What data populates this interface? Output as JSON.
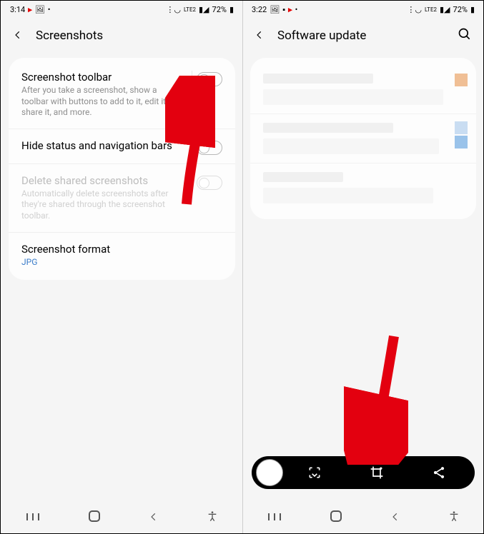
{
  "left": {
    "status": {
      "time": "3:14",
      "battery": "72%",
      "lte": "LTE2"
    },
    "header": {
      "title": "Screenshots"
    },
    "rows": {
      "toolbar": {
        "title": "Screenshot toolbar",
        "desc": "After you take a screenshot, show a toolbar with buttons to add to it, edit it, share it, and more."
      },
      "hide": {
        "title": "Hide status and navigation bars"
      },
      "delete": {
        "title": "Delete shared screenshots",
        "desc": "Automatically delete screenshots after they're shared through the screenshot toolbar."
      },
      "format": {
        "title": "Screenshot format",
        "value": "JPG"
      }
    }
  },
  "right": {
    "status": {
      "time": "3:22",
      "battery": "72%",
      "lte": "LTE2"
    },
    "header": {
      "title": "Software update"
    }
  }
}
